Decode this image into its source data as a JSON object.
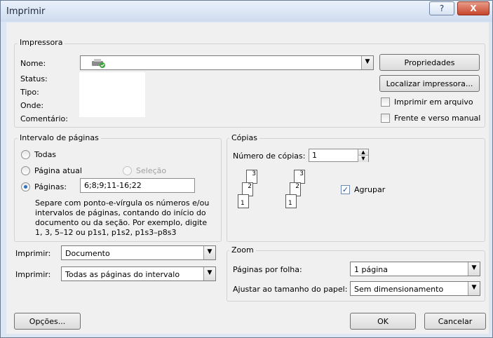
{
  "window": {
    "title": "Imprimir",
    "help_glyph": "?",
    "close_glyph": "X"
  },
  "printer": {
    "group_label": "Impressora",
    "name_label": "Nome:",
    "name_value": "",
    "status_label": "Status:",
    "type_label": "Tipo:",
    "where_label": "Onde:",
    "comment_label": "Comentário:",
    "properties_button": "Propriedades",
    "find_printer_button": "Localizar impressora...",
    "print_to_file_label": "Imprimir em arquivo",
    "print_to_file_checked": false,
    "manual_duplex_label": "Frente e verso manual",
    "manual_duplex_checked": false
  },
  "page_range": {
    "group_label": "Intervalo de páginas",
    "all_label": "Todas",
    "current_label": "Página atual",
    "selection_label": "Seleção",
    "pages_label": "Páginas:",
    "pages_value": "6;8;9;11-16;22",
    "selected": "pages",
    "help_lines": [
      "Separe com ponto-e-vírgula os números e/ou",
      "intervalos de páginas, contando do início do",
      "documento ou da seção. Por exemplo, digite",
      "1, 3, 5–12 ou p1s1, p1s2, p1s3–p8s3"
    ]
  },
  "copies": {
    "group_label": "Cópias",
    "count_label": "Número de cópias:",
    "count_value": "1",
    "collate_label": "Agrupar",
    "collate_checked": true,
    "page_numbers": [
      "1",
      "2",
      "3"
    ]
  },
  "print_what": {
    "label": "Imprimir:",
    "value": "Documento"
  },
  "print_range": {
    "label": "Imprimir:",
    "value": "Todas as páginas do intervalo"
  },
  "zoom": {
    "group_label": "Zoom",
    "pages_per_sheet_label": "Páginas por folha:",
    "pages_per_sheet_value": "1 página",
    "scale_label": "Ajustar ao tamanho do papel:",
    "scale_value": "Sem dimensionamento"
  },
  "footer": {
    "options_button": "Opções...",
    "ok_button": "OK",
    "cancel_button": "Cancelar"
  },
  "icons": {
    "check_glyph": "✓",
    "dropdown_glyph": "▼",
    "spin_up_glyph": "▲",
    "spin_down_glyph": "▼"
  }
}
